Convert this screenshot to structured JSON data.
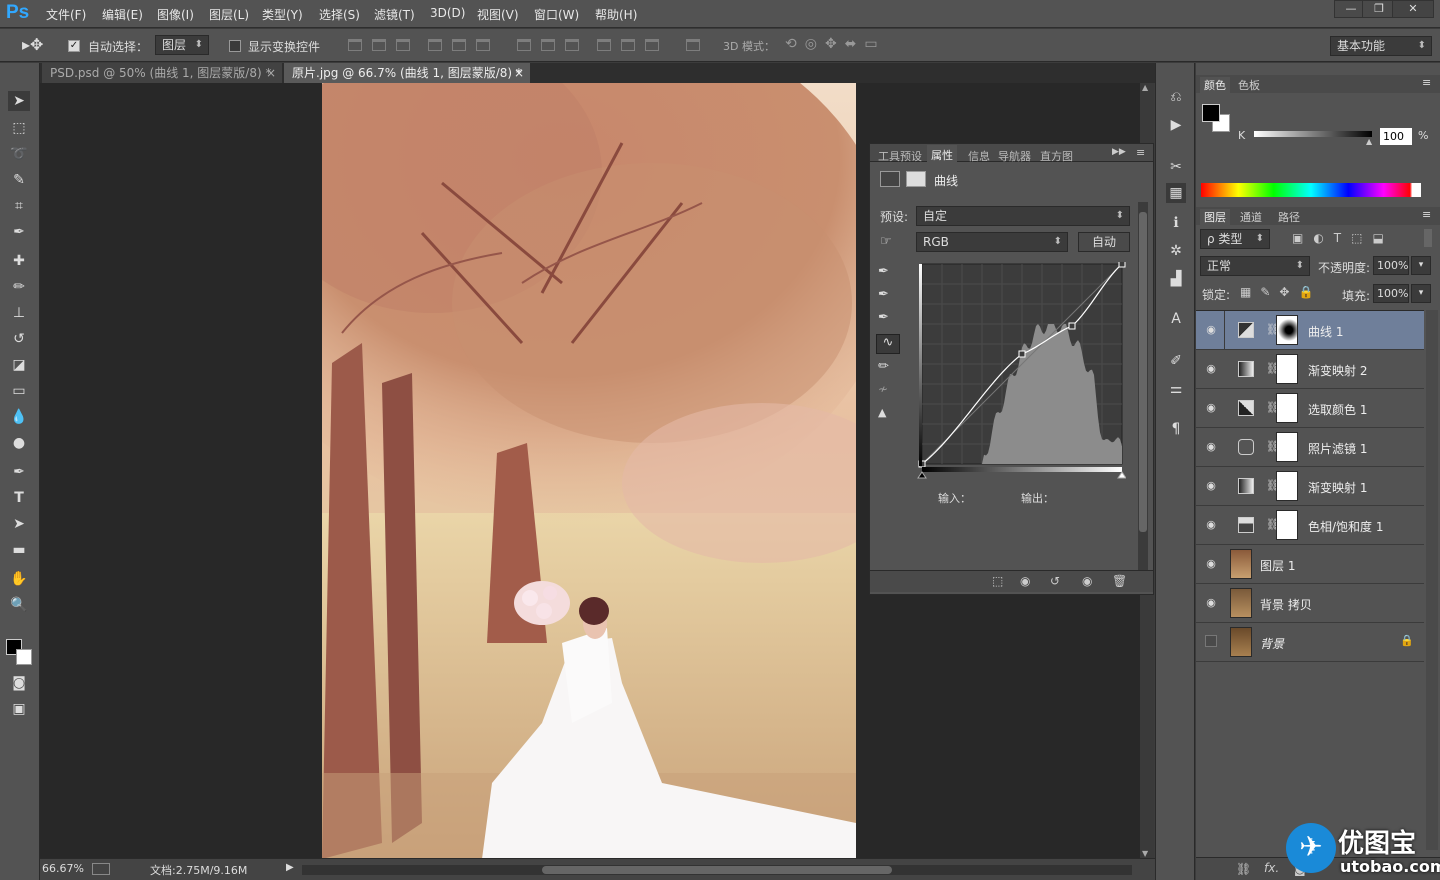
{
  "app": {
    "logo": "Ps"
  },
  "menus": [
    "文件(F)",
    "编辑(E)",
    "图像(I)",
    "图层(L)",
    "类型(Y)",
    "选择(S)",
    "滤镜(T)",
    "3D(D)",
    "视图(V)",
    "窗口(W)",
    "帮助(H)"
  ],
  "window_controls": {
    "minimize": "—",
    "restore": "❐",
    "close": "✕"
  },
  "options": {
    "auto_select_label": "自动选择：",
    "auto_select_checked": true,
    "auto_select_target": "图层",
    "show_transform_label": "显示变换控件",
    "mode_3d_label": "3D 模式：",
    "workspace": "基本功能"
  },
  "tabs": [
    {
      "label": "PSD.psd @ 50% (曲线 1, 图层蒙版/8) *",
      "close": "×",
      "active": false
    },
    {
      "label": "原片.jpg @ 66.7% (曲线 1, 图层蒙版/8) *",
      "close": "×",
      "active": true
    }
  ],
  "status": {
    "zoom": "66.67%",
    "doc": "文档:2.75M/9.16M"
  },
  "properties": {
    "tabs": [
      "工具预设",
      "属性",
      "信息",
      "导航器",
      "直方图"
    ],
    "active_tab": "属性",
    "title": "曲线",
    "preset_label": "预设:",
    "preset_value": "自定",
    "channel": "RGB",
    "auto_button": "自动",
    "input_label": "输入：",
    "output_label": "输出：",
    "curve_points": [
      [
        0,
        0
      ],
      [
        0.5,
        0.55
      ],
      [
        0.75,
        0.69
      ],
      [
        1,
        1
      ]
    ]
  },
  "color_panel": {
    "tabs": [
      "颜色",
      "色板"
    ],
    "channel_label": "K",
    "value": "100",
    "unit": "%",
    "foreground": "#000000",
    "background": "#ffffff"
  },
  "layers_panel": {
    "tabs": [
      "图层",
      "通道",
      "路径"
    ],
    "filter": "ρ 类型",
    "blend_mode": "正常",
    "opacity_label": "不透明度:",
    "opacity": "100%",
    "lock_label": "锁定:",
    "fill_label": "填充:",
    "fill": "100%",
    "layers": [
      {
        "name": "曲线 1",
        "kind": "adjustment",
        "selected": true,
        "visible": true
      },
      {
        "name": "渐变映射 2",
        "kind": "adjustment",
        "selected": false,
        "visible": true
      },
      {
        "name": "选取颜色 1",
        "kind": "adjustment",
        "selected": false,
        "visible": true
      },
      {
        "name": "照片滤镜 1",
        "kind": "adjustment",
        "selected": false,
        "visible": true
      },
      {
        "name": "渐变映射 1",
        "kind": "adjustment",
        "selected": false,
        "visible": true
      },
      {
        "name": "色相/饱和度 1",
        "kind": "adjustment",
        "selected": false,
        "visible": true
      },
      {
        "name": "图层 1",
        "kind": "pixel",
        "selected": false,
        "visible": true
      },
      {
        "name": "背景 拷贝",
        "kind": "pixel",
        "selected": false,
        "visible": true
      },
      {
        "name": "背景",
        "kind": "background",
        "selected": false,
        "visible": false,
        "locked": true
      }
    ]
  },
  "watermark": {
    "brand": "优图宝",
    "url": "utobao.com"
  },
  "colors": {
    "accent": "#31a8ff",
    "selected_layer": "#6f7f9a"
  }
}
